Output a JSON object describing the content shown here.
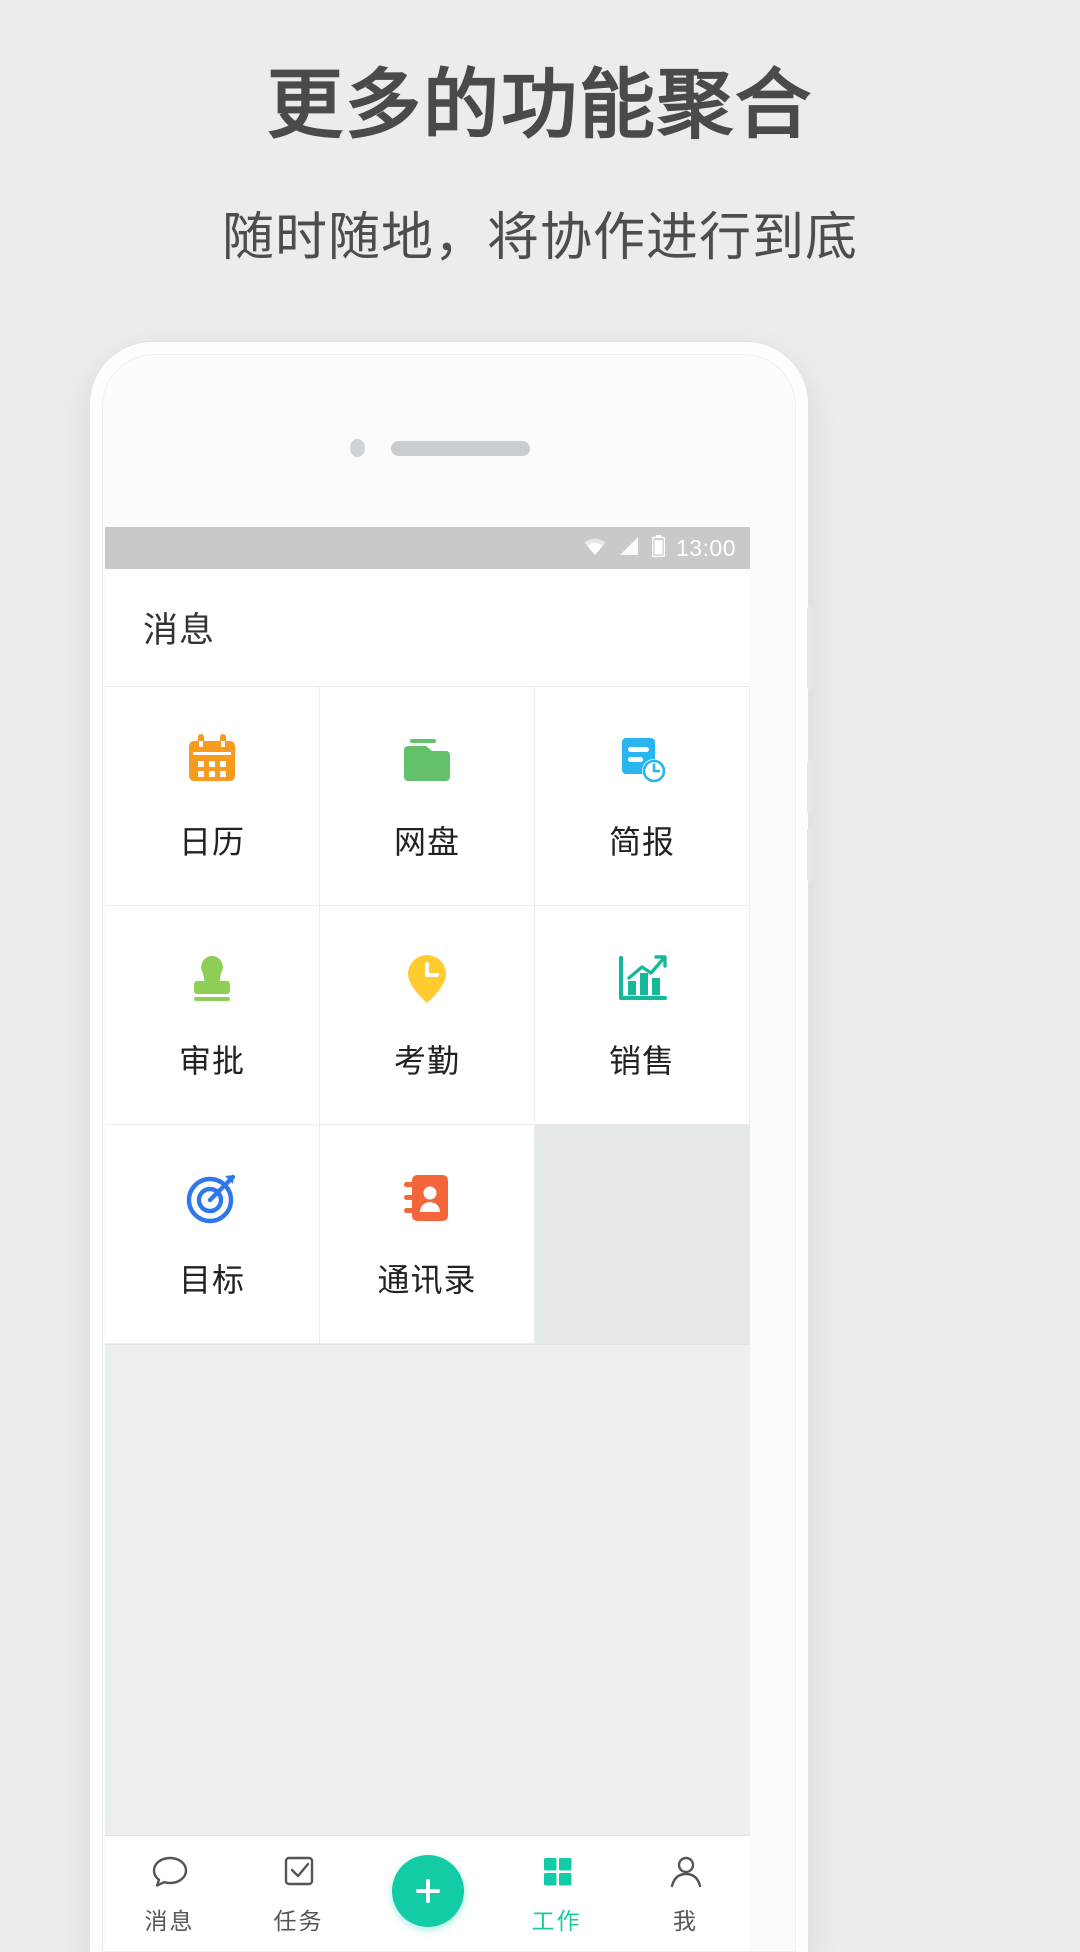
{
  "promo": {
    "title": "更多的功能聚合",
    "subtitle": "随时随地，将协作进行到底"
  },
  "phone": {
    "statusbar": {
      "time": "13:00",
      "icons": [
        "wifi-icon",
        "signal-icon",
        "battery-icon"
      ]
    },
    "appbar": {
      "title": "消息"
    },
    "grid": {
      "items": [
        {
          "label": "日历",
          "icon": "calendar-icon",
          "color": "#f79a1e"
        },
        {
          "label": "网盘",
          "icon": "folder-icon",
          "color": "#62c16a"
        },
        {
          "label": "简报",
          "icon": "report-icon",
          "color": "#29b6f0"
        },
        {
          "label": "审批",
          "icon": "stamp-icon",
          "color": "#8ccf54"
        },
        {
          "label": "考勤",
          "icon": "pin-clock-icon",
          "color": "#ffcb2e"
        },
        {
          "label": "销售",
          "icon": "chart-icon",
          "color": "#16b89a"
        },
        {
          "label": "目标",
          "icon": "target-icon",
          "color": "#2f77ea"
        },
        {
          "label": "通讯录",
          "icon": "contacts-icon",
          "color": "#f4653a"
        }
      ]
    },
    "bottomnav": {
      "items": [
        {
          "label": "消息",
          "icon": "chat-icon",
          "active": false
        },
        {
          "label": "任务",
          "icon": "check-icon",
          "active": false
        },
        {
          "label": "",
          "icon": "plus-icon",
          "active": false
        },
        {
          "label": "工作",
          "icon": "grid-icon",
          "active": true
        },
        {
          "label": "我",
          "icon": "user-icon",
          "active": false
        }
      ],
      "accent_color": "#14cba8"
    }
  }
}
